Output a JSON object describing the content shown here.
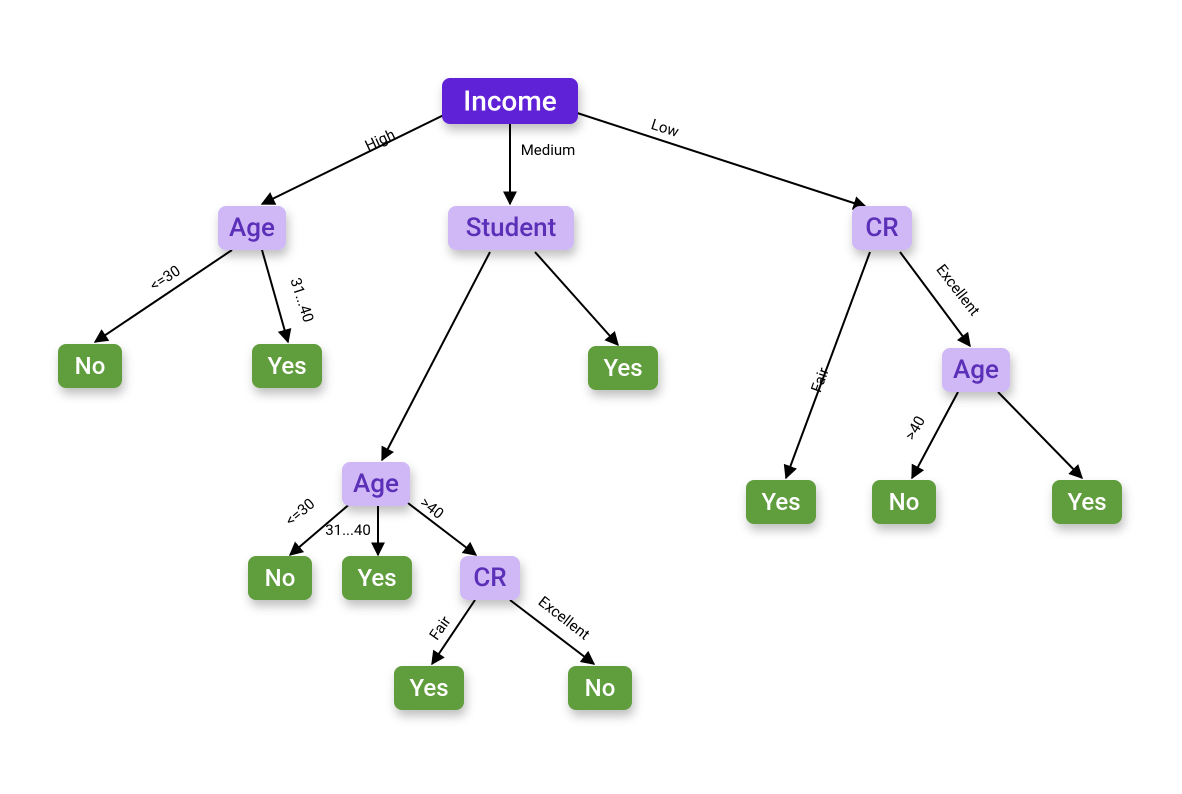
{
  "diagram": {
    "type": "decision-tree",
    "nodes": {
      "root": {
        "label": "Income",
        "kind": "root"
      },
      "age1": {
        "label": "Age",
        "kind": "attr"
      },
      "student": {
        "label": "Student",
        "kind": "attr"
      },
      "cr1": {
        "label": "CR",
        "kind": "attr"
      },
      "no1": {
        "label": "No",
        "kind": "leaf"
      },
      "yes1": {
        "label": "Yes",
        "kind": "leaf"
      },
      "age2": {
        "label": "Age",
        "kind": "attr"
      },
      "yes2": {
        "label": "Yes",
        "kind": "leaf"
      },
      "no2": {
        "label": "No",
        "kind": "leaf"
      },
      "yes3": {
        "label": "Yes",
        "kind": "leaf"
      },
      "cr2": {
        "label": "CR",
        "kind": "attr"
      },
      "yes4": {
        "label": "Yes",
        "kind": "leaf"
      },
      "no3": {
        "label": "No",
        "kind": "leaf"
      },
      "yes5": {
        "label": "Yes",
        "kind": "leaf"
      },
      "age3": {
        "label": "Age",
        "kind": "attr"
      },
      "no4": {
        "label": "No",
        "kind": "leaf"
      },
      "yes6": {
        "label": "Yes",
        "kind": "leaf"
      }
    },
    "edges": {
      "e1": {
        "from": "root",
        "to": "age1",
        "label": "High"
      },
      "e2": {
        "from": "root",
        "to": "student",
        "label": "Medium"
      },
      "e3": {
        "from": "root",
        "to": "cr1",
        "label": "Low"
      },
      "e4": {
        "from": "age1",
        "to": "no1",
        "label": "<=30"
      },
      "e5": {
        "from": "age1",
        "to": "yes1",
        "label": "31...40"
      },
      "e6": {
        "from": "student",
        "to": "age2",
        "label": ""
      },
      "e7": {
        "from": "student",
        "to": "yes2",
        "label": ""
      },
      "e8": {
        "from": "age2",
        "to": "no2",
        "label": "<=30"
      },
      "e9": {
        "from": "age2",
        "to": "yes3",
        "label": "31...40"
      },
      "e10": {
        "from": "age2",
        "to": "cr2",
        "label": ">40"
      },
      "e11": {
        "from": "cr2",
        "to": "yes4",
        "label": "Fair"
      },
      "e12": {
        "from": "cr2",
        "to": "no3",
        "label": "Excellent"
      },
      "e13": {
        "from": "cr1",
        "to": "yes5",
        "label": "Fair"
      },
      "e14": {
        "from": "cr1",
        "to": "age3",
        "label": "Excellent"
      },
      "e15": {
        "from": "age3",
        "to": "no4",
        "label": ">40"
      },
      "e16": {
        "from": "age3",
        "to": "yes6",
        "label": ""
      }
    }
  }
}
